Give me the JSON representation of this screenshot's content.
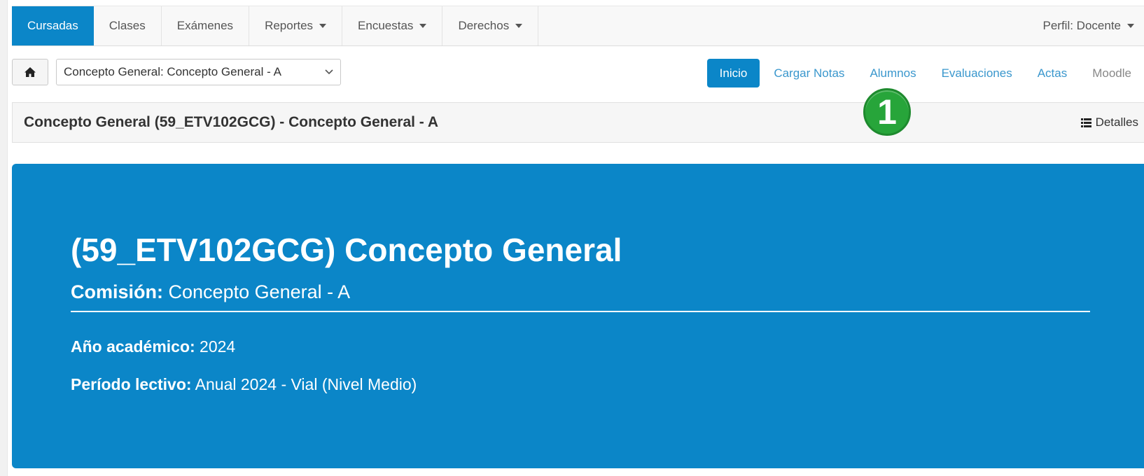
{
  "nav": {
    "tabs": [
      {
        "label": "Cursadas"
      },
      {
        "label": "Clases"
      },
      {
        "label": "Exámenes"
      },
      {
        "label": "Reportes"
      },
      {
        "label": "Encuestas"
      },
      {
        "label": "Derechos"
      }
    ],
    "profile": "Perfil: Docente"
  },
  "toolbar": {
    "home_icon": "home-icon",
    "course_select": "Concepto General: Concepto General - A"
  },
  "pills": [
    {
      "label": "Inicio"
    },
    {
      "label": "Cargar Notas"
    },
    {
      "label": "Alumnos"
    },
    {
      "label": "Evaluaciones"
    },
    {
      "label": "Actas"
    },
    {
      "label": "Moodle"
    }
  ],
  "header": {
    "title": "Concepto General (59_ETV102GCG) - Concepto General - A",
    "details_label": "Detalles"
  },
  "badge": {
    "number": "1",
    "color": "#27a53a"
  },
  "hero": {
    "title": "(59_ETV102GCG) Concepto General",
    "comision_label": "Comisión:",
    "comision_value": "Concepto General - A",
    "year_label": "Año académico:",
    "year_value": "2024",
    "period_label": "Período lectivo:",
    "period_value": "Anual 2024 - Vial (Nivel Medio)"
  },
  "colors": {
    "primary": "#0b86c8",
    "link": "#3a97cd",
    "badge": "#27a53a"
  }
}
